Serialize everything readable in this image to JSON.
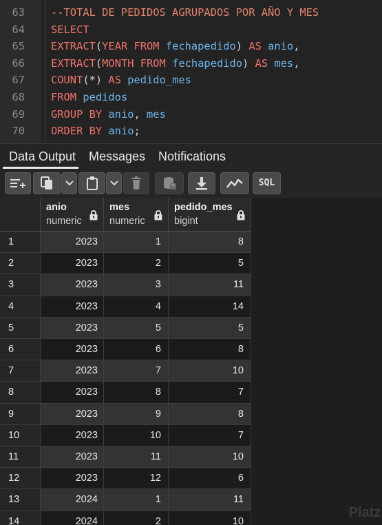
{
  "editor": {
    "lines": [
      {
        "n": "63",
        "tokens": [
          {
            "t": "--TOTAL DE PEDIDOS AGRUPADOS POR AÑO Y MES",
            "c": "cm"
          }
        ]
      },
      {
        "n": "64",
        "tokens": [
          {
            "t": "SELECT",
            "c": "kw"
          }
        ]
      },
      {
        "n": "65",
        "tokens": [
          {
            "t": "EXTRACT",
            "c": "kw"
          },
          {
            "t": "(",
            "c": "op"
          },
          {
            "t": "YEAR FROM",
            "c": "kw"
          },
          {
            "t": " fechapedido",
            "c": "id"
          },
          {
            "t": ") ",
            "c": "op"
          },
          {
            "t": "AS",
            "c": "kw"
          },
          {
            "t": " anio",
            "c": "id"
          },
          {
            "t": ",",
            "c": "op"
          }
        ]
      },
      {
        "n": "66",
        "tokens": [
          {
            "t": "EXTRACT",
            "c": "kw"
          },
          {
            "t": "(",
            "c": "op"
          },
          {
            "t": "MONTH FROM",
            "c": "kw"
          },
          {
            "t": " fechapedido",
            "c": "id"
          },
          {
            "t": ") ",
            "c": "op"
          },
          {
            "t": "AS",
            "c": "kw"
          },
          {
            "t": " mes",
            "c": "id"
          },
          {
            "t": ",",
            "c": "op"
          }
        ]
      },
      {
        "n": "67",
        "tokens": [
          {
            "t": "COUNT",
            "c": "kw"
          },
          {
            "t": "(*) ",
            "c": "op"
          },
          {
            "t": "AS",
            "c": "kw"
          },
          {
            "t": " pedido_mes",
            "c": "id"
          }
        ]
      },
      {
        "n": "68",
        "tokens": [
          {
            "t": "FROM",
            "c": "kw"
          },
          {
            "t": " pedidos",
            "c": "id"
          }
        ]
      },
      {
        "n": "69",
        "tokens": [
          {
            "t": "GROUP BY",
            "c": "kw"
          },
          {
            "t": " anio",
            "c": "id"
          },
          {
            "t": ", ",
            "c": "op"
          },
          {
            "t": "mes",
            "c": "id"
          }
        ]
      },
      {
        "n": "70",
        "tokens": [
          {
            "t": "ORDER BY",
            "c": "kw"
          },
          {
            "t": " anio",
            "c": "id"
          },
          {
            "t": ";",
            "c": "op"
          }
        ]
      }
    ]
  },
  "tabs": [
    {
      "label": "Data Output",
      "active": true
    },
    {
      "label": "Messages",
      "active": false
    },
    {
      "label": "Notifications",
      "active": false
    }
  ],
  "toolbar": {
    "sql_label": "SQL",
    "icons": [
      "add-row-icon",
      "copy-icon",
      "chevron-down-icon",
      "paste-icon",
      "chevron-down-icon",
      "delete-icon",
      "save-data-icon",
      "download-icon",
      "graph-icon",
      "sql-icon"
    ]
  },
  "grid": {
    "columns": [
      {
        "name": "anio",
        "type": "numeric"
      },
      {
        "name": "mes",
        "type": "numeric"
      },
      {
        "name": "pedido_mes",
        "type": "bigint"
      }
    ],
    "rows": [
      [
        "1",
        "2023",
        "1",
        "8"
      ],
      [
        "2",
        "2023",
        "2",
        "5"
      ],
      [
        "3",
        "2023",
        "3",
        "11"
      ],
      [
        "4",
        "2023",
        "4",
        "14"
      ],
      [
        "5",
        "2023",
        "5",
        "5"
      ],
      [
        "6",
        "2023",
        "6",
        "8"
      ],
      [
        "7",
        "2023",
        "7",
        "10"
      ],
      [
        "8",
        "2023",
        "8",
        "7"
      ],
      [
        "9",
        "2023",
        "9",
        "8"
      ],
      [
        "10",
        "2023",
        "10",
        "7"
      ],
      [
        "11",
        "2023",
        "11",
        "10"
      ],
      [
        "12",
        "2023",
        "12",
        "6"
      ],
      [
        "13",
        "2024",
        "1",
        "11"
      ],
      [
        "14",
        "2024",
        "2",
        "10"
      ]
    ]
  },
  "watermark": "Platzi"
}
